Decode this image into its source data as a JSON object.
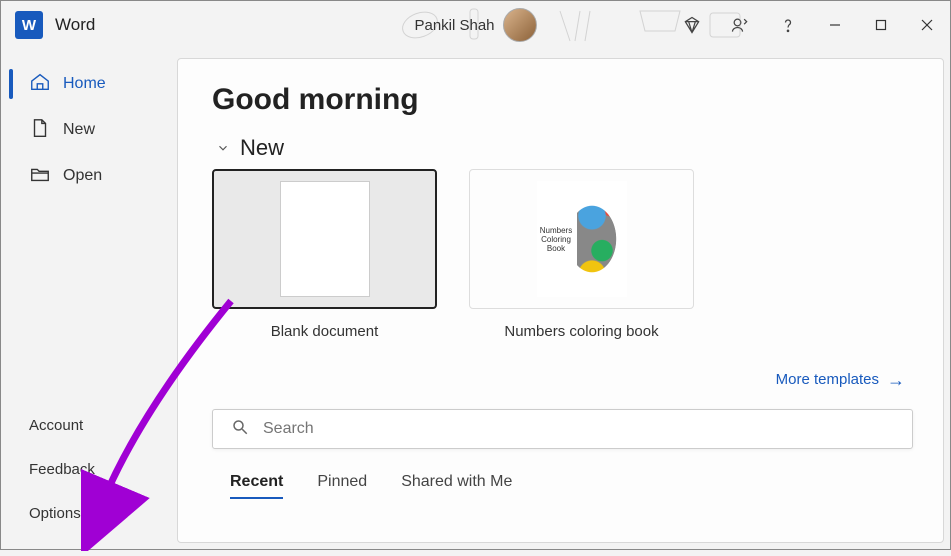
{
  "titlebar": {
    "app_title": "Word",
    "app_icon_letter": "W",
    "user_name": "Pankil Shah"
  },
  "sidebar": {
    "top_items": [
      {
        "label": "Home",
        "icon": "home"
      },
      {
        "label": "New",
        "icon": "document"
      },
      {
        "label": "Open",
        "icon": "folder"
      }
    ],
    "bottom_items": [
      {
        "label": "Account"
      },
      {
        "label": "Feedback"
      },
      {
        "label": "Options"
      }
    ]
  },
  "main": {
    "greeting": "Good morning",
    "new_section": {
      "title": "New",
      "templates": [
        {
          "label": "Blank document"
        },
        {
          "label": "Numbers coloring book",
          "side_text": "Numbers Coloring Book"
        }
      ],
      "more_link": "More templates"
    },
    "search": {
      "placeholder": "Search"
    },
    "tabs": [
      {
        "label": "Recent",
        "active": true
      },
      {
        "label": "Pinned",
        "active": false
      },
      {
        "label": "Shared with Me",
        "active": false
      }
    ]
  }
}
